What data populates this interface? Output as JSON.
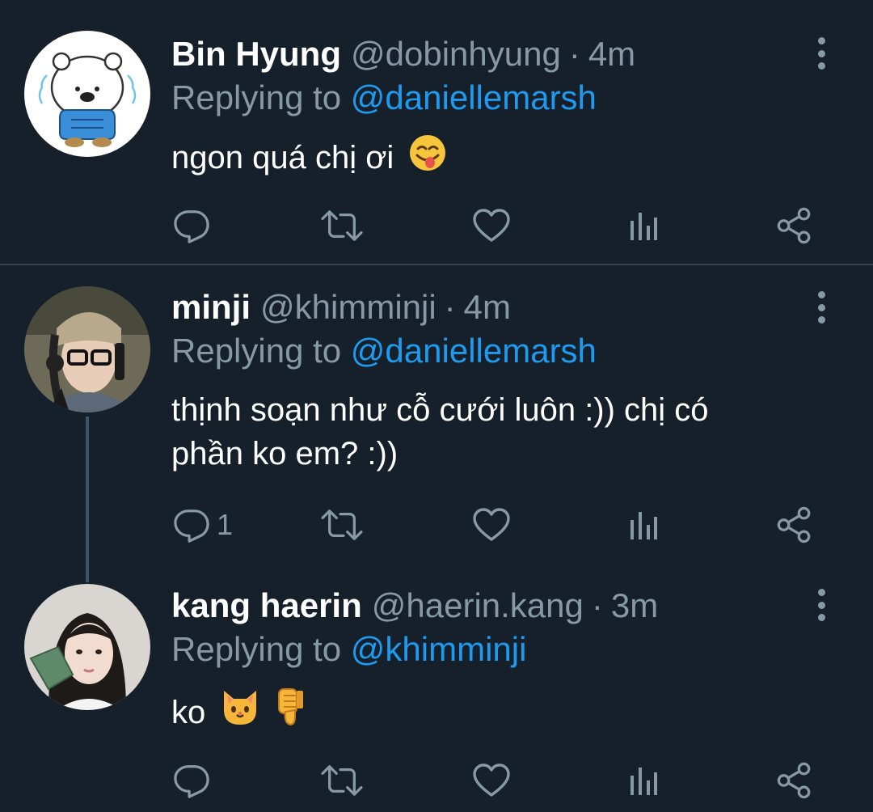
{
  "tweets": [
    {
      "name": "Bin Hyung",
      "handle": "@dobinhyung",
      "separator": "·",
      "time": "4m",
      "replying_prefix": "Replying to",
      "replying_to": "@daniellemarsh",
      "text": "ngon quá chị ơi",
      "text_emoji": "face-savoring-food-emoji",
      "reply_count": "",
      "avatar": "white-bear-avatar"
    },
    {
      "name": "minji",
      "handle": "@khimminji",
      "separator": "·",
      "time": "4m",
      "replying_prefix": "Replying to",
      "replying_to": "@daniellemarsh",
      "text_line1": "thịnh soạn như cỗ cưới luôn :)) chị có",
      "text_line2": "phần ko em? :))",
      "reply_count": "1",
      "avatar": "girl-with-headphones-avatar"
    },
    {
      "name": "kang haerin",
      "handle": "@haerin.kang",
      "separator": "·",
      "time": "3m",
      "replying_prefix": "Replying to",
      "replying_to": "@khimminji",
      "text": "ko",
      "text_emojis": [
        "cat-face-emoji",
        "thumbs-down-emoji"
      ],
      "reply_count": "",
      "avatar": "girl-selfie-avatar"
    }
  ],
  "icons": {
    "reply": "reply-icon",
    "retweet": "retweet-icon",
    "like": "heart-icon",
    "analytics": "analytics-icon",
    "share": "share-icon",
    "more": "more-vertical-icon"
  },
  "colors": {
    "background": "#15202b",
    "primary_text": "#ffffff",
    "secondary_text": "#8899a6",
    "mention": "#1d9bf0",
    "divider": "#38444d"
  }
}
